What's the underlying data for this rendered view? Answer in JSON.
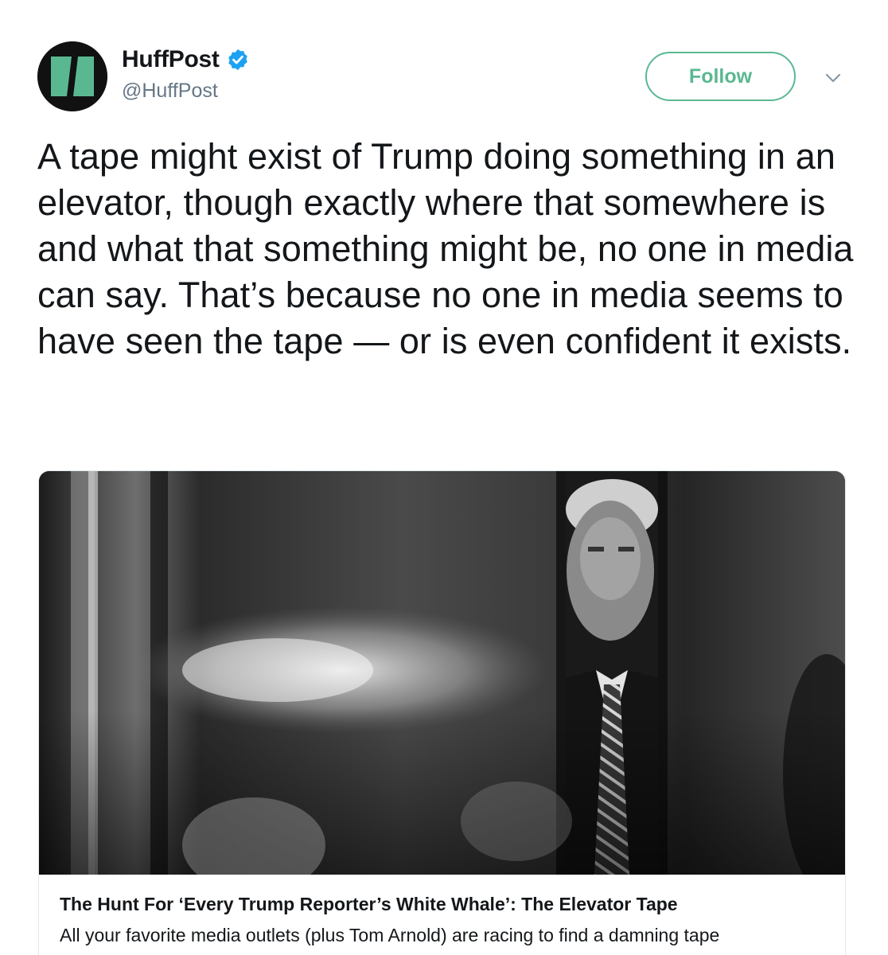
{
  "author": {
    "display_name": "HuffPost",
    "handle": "@HuffPost",
    "avatar_icon": "huffpost-logo",
    "verified_icon": "verified-badge-icon"
  },
  "actions": {
    "follow_label": "Follow",
    "menu_icon": "chevron-down-icon"
  },
  "tweet": {
    "text": "A tape might exist of Trump doing something in an elevator, though exactly where that somewhere is and what that something might be, no one in media can say. That’s because no one in media seems to have seen the tape — or is even confident it exists."
  },
  "card": {
    "image_icon": "article-photo",
    "title": "The Hunt For ‘Every Trump Reporter’s White Whale’: The Elevator Tape",
    "description": "All your favorite media outlets (plus Tom Arnold) are racing to find a damning tape"
  },
  "colors": {
    "brand_green": "#5ab891",
    "verified_blue": "#1da1f2",
    "text": "#14171a",
    "secondary_text": "#657786"
  }
}
